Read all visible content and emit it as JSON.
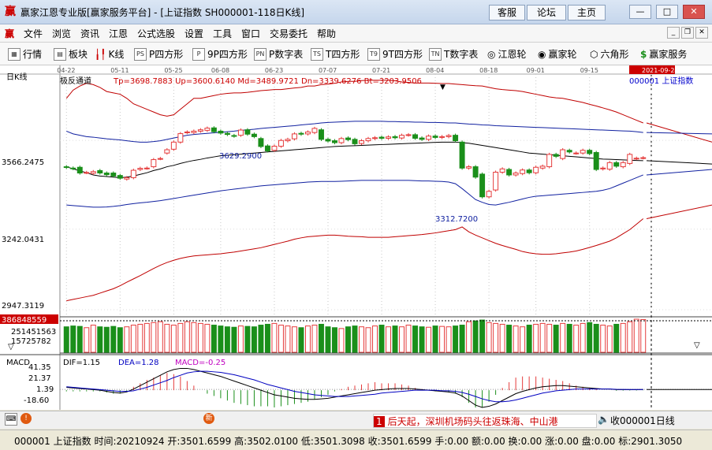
{
  "window": {
    "title": "赢家江恩专业版[赢家服务平台] - [上证指数  SH000001-118日K线]",
    "buttons": {
      "support": "客服",
      "forum": "论坛",
      "home": "主页"
    }
  },
  "menu": [
    "文件",
    "浏览",
    "资讯",
    "江恩",
    "公式选股",
    "设置",
    "工具",
    "窗口",
    "交易委托",
    "帮助"
  ],
  "toolbar": [
    "行情",
    "板块",
    "K线",
    "P四方形",
    "9P四方形",
    "P数字表",
    "T四方形",
    "9T四方形",
    "T数字表",
    "江恩轮",
    "赢家轮",
    "六角形",
    "赢家服务"
  ],
  "chart": {
    "panel_label": "日K线",
    "indicator_name": "极反通道",
    "indicator_values": "Tp=3698.7883  Up=3600.6140  Md=3489.9721  Dn=3339.6276  Bt=3203.9506",
    "symbol_label": "000001  上证指数",
    "date_ticks": [
      "04-22",
      "05-11",
      "05-25",
      "06-08",
      "06-23",
      "07-07",
      "07-21",
      "08-04",
      "08-18",
      "09-01",
      "09-15",
      "2021-09-24"
    ],
    "price_ticks": [
      "3566.2475",
      "3242.0431",
      "2947.3119"
    ],
    "annotations": {
      "high": "3629.2900",
      "low": "3312.7200"
    },
    "volume_ticks": [
      "386848559",
      "251451563",
      "15725782"
    ],
    "macd_label": "MACD",
    "dif": "DIF=1.15",
    "dea": "DEA=1.28",
    "macd": "MACD=-0.25",
    "macd_ticks": [
      "41.35",
      "21.37",
      "1.39",
      "-18.60"
    ]
  },
  "status": {
    "ticker": "后天起，深圳机场码头往返珠海、中山港",
    "right_label": "收000001日线"
  },
  "bottom": {
    "info": "000001 上证指数 时间:20210924 开:3501.6599 高:3502.0100 低:3501.3098 收:3501.6599 手:0.00 额:0.00 换:0.00 涨:0.00 盘:0.00 标:2901.3050"
  },
  "colors": {
    "up": "#e53c3c",
    "down": "#1a8f1a",
    "band_red": "#c00000",
    "band_blue": "#1020a0",
    "mid": "#000000"
  },
  "chart_data": {
    "type": "candlestick",
    "open": [
      3470,
      3465,
      3468,
      3449,
      3446,
      3456,
      3447,
      3447,
      3438,
      3425,
      3430,
      3460,
      3465,
      3470,
      3500,
      3520,
      3534,
      3560,
      3595,
      3595,
      3600,
      3603,
      3612,
      3600,
      3592,
      3584,
      3585,
      3605,
      3589,
      3573,
      3546,
      3530,
      3545,
      3565,
      3572,
      3592,
      3590,
      3595,
      3605,
      3570,
      3565,
      3558,
      3575,
      3570,
      3555,
      3565,
      3573,
      3578,
      3574,
      3580,
      3575,
      3586,
      3587,
      3575,
      3570,
      3582,
      3577,
      3580,
      3585,
      3560,
      3465,
      3470,
      3443,
      3360,
      3385,
      3450,
      3460,
      3440,
      3445,
      3458,
      3448,
      3465,
      3470,
      3515,
      3500,
      3530,
      3520,
      3520,
      3530,
      3522,
      3462,
      3461,
      3485,
      3470,
      3482,
      3500,
      3503
    ],
    "close": [
      3468,
      3463,
      3447,
      3449,
      3452,
      3447,
      3441,
      3436,
      3428,
      3430,
      3457,
      3464,
      3465,
      3496,
      3500,
      3532,
      3560,
      3591,
      3597,
      3600,
      3605,
      3611,
      3598,
      3593,
      3588,
      3582,
      3604,
      3589,
      3580,
      3544,
      3528,
      3545,
      3566,
      3570,
      3590,
      3589,
      3597,
      3610,
      3570,
      3564,
      3558,
      3573,
      3569,
      3554,
      3565,
      3573,
      3576,
      3574,
      3579,
      3576,
      3585,
      3587,
      3574,
      3570,
      3582,
      3577,
      3580,
      3584,
      3565,
      3465,
      3470,
      3432,
      3360,
      3380,
      3450,
      3462,
      3440,
      3447,
      3458,
      3448,
      3468,
      3472,
      3515,
      3508,
      3532,
      3524,
      3520,
      3530,
      3518,
      3460,
      3465,
      3485,
      3472,
      3485,
      3515,
      3501,
      3503
    ],
    "tp": [
      3720,
      3750,
      3765,
      3775,
      3770,
      3760,
      3745,
      3740,
      3735,
      3720,
      3700,
      3690,
      3680,
      3670,
      3660,
      3655,
      3660,
      3680,
      3700,
      3720,
      3720,
      3725,
      3730,
      3735,
      3738,
      3740,
      3740,
      3742,
      3745,
      3748,
      3750,
      3752,
      3752,
      3755,
      3758,
      3760,
      3765,
      3765,
      3770,
      3772,
      3775,
      3780,
      3782,
      3782,
      3785,
      3786,
      3786,
      3786,
      3786,
      3784,
      3780,
      3778,
      3776,
      3776,
      3776,
      3775,
      3774,
      3774,
      3772,
      3770,
      3768,
      3766,
      3765,
      3760,
      3755,
      3752,
      3750,
      3748,
      3745,
      3740,
      3735,
      3730,
      3725,
      3722,
      3720,
      3715,
      3710,
      3705,
      3698,
      3692,
      3685,
      3678,
      3670,
      3660,
      3650,
      3640,
      3630
    ],
    "up": [
      3600,
      3590,
      3585,
      3580,
      3578,
      3575,
      3572,
      3570,
      3568,
      3565,
      3562,
      3560,
      3560,
      3562,
      3565,
      3570,
      3575,
      3580,
      3585,
      3588,
      3590,
      3592,
      3594,
      3596,
      3598,
      3600,
      3603,
      3605,
      3607,
      3610,
      3612,
      3614,
      3616,
      3618,
      3620,
      3623,
      3625,
      3627,
      3630,
      3632,
      3633,
      3634,
      3635,
      3636,
      3636,
      3636,
      3636,
      3636,
      3635,
      3635,
      3634,
      3634,
      3633,
      3633,
      3632,
      3632,
      3631,
      3630,
      3630,
      3628,
      3626,
      3625,
      3623,
      3622,
      3620,
      3619,
      3618,
      3617,
      3616,
      3615,
      3614,
      3613,
      3612,
      3611,
      3610,
      3609,
      3608,
      3607,
      3606,
      3605,
      3604,
      3603,
      3602,
      3601,
      3600,
      3598,
      3595
    ],
    "mid": [
      3470,
      3462,
      3455,
      3448,
      3440,
      3436,
      3434,
      3432,
      3430,
      3432,
      3436,
      3442,
      3448,
      3456,
      3462,
      3470,
      3475,
      3482,
      3488,
      3493,
      3497,
      3502,
      3506,
      3510,
      3512,
      3514,
      3516,
      3518,
      3520,
      3522,
      3524,
      3526,
      3528,
      3530,
      3532,
      3534,
      3536,
      3538,
      3540,
      3542,
      3544,
      3545,
      3546,
      3547,
      3548,
      3549,
      3550,
      3551,
      3552,
      3553,
      3554,
      3555,
      3556,
      3557,
      3558,
      3559,
      3560,
      3560,
      3560,
      3558,
      3556,
      3552,
      3548,
      3544,
      3540,
      3536,
      3532,
      3528,
      3524,
      3520,
      3518,
      3516,
      3514,
      3512,
      3510,
      3508,
      3506,
      3504,
      3502,
      3500,
      3498,
      3497,
      3496,
      3495,
      3494,
      3493,
      3492
    ],
    "dn": [
      3330,
      3328,
      3326,
      3324,
      3322,
      3322,
      3323,
      3325,
      3328,
      3332,
      3335,
      3338,
      3340,
      3343,
      3346,
      3350,
      3354,
      3358,
      3362,
      3366,
      3370,
      3374,
      3378,
      3382,
      3385,
      3388,
      3391,
      3394,
      3397,
      3400,
      3402,
      3404,
      3406,
      3408,
      3410,
      3412,
      3414,
      3415,
      3416,
      3416,
      3416,
      3417,
      3418,
      3419,
      3420,
      3420,
      3420,
      3420,
      3420,
      3420,
      3420,
      3420,
      3419,
      3418,
      3418,
      3417,
      3416,
      3414,
      3408,
      3390,
      3370,
      3350,
      3340,
      3332,
      3330,
      3335,
      3340,
      3346,
      3352,
      3358,
      3362,
      3364,
      3366,
      3368,
      3370,
      3372,
      3374,
      3376,
      3378,
      3380,
      3384,
      3390,
      3400,
      3410,
      3420,
      3430,
      3440
    ],
    "bt": [
      2980,
      2985,
      2990,
      2995,
      3000,
      3008,
      3016,
      3024,
      3035,
      3048,
      3060,
      3072,
      3085,
      3098,
      3110,
      3120,
      3128,
      3135,
      3140,
      3144,
      3146,
      3148,
      3150,
      3152,
      3155,
      3158,
      3162,
      3166,
      3170,
      3174,
      3180,
      3186,
      3192,
      3198,
      3205,
      3210,
      3214,
      3216,
      3218,
      3220,
      3220,
      3218,
      3216,
      3215,
      3214,
      3212,
      3212,
      3212,
      3212,
      3214,
      3216,
      3218,
      3220,
      3222,
      3225,
      3228,
      3232,
      3236,
      3240,
      3250,
      3232,
      3220,
      3210,
      3200,
      3190,
      3182,
      3175,
      3168,
      3160,
      3155,
      3152,
      3150,
      3150,
      3152,
      3155,
      3158,
      3162,
      3168,
      3175,
      3182,
      3190,
      3198,
      3210,
      3225,
      3240,
      3260,
      3280
    ],
    "volume": [
      300,
      310,
      305,
      290,
      320,
      300,
      295,
      305,
      290,
      300,
      320,
      330,
      340,
      350,
      360,
      330,
      320,
      340,
      360,
      350,
      340,
      330,
      320,
      310,
      300,
      295,
      310,
      305,
      300,
      320,
      330,
      340,
      320,
      310,
      300,
      290,
      310,
      320,
      330,
      300,
      290,
      280,
      300,
      310,
      300,
      290,
      310,
      320,
      300,
      310,
      300,
      320,
      310,
      300,
      295,
      310,
      305,
      300,
      310,
      320,
      360,
      370,
      380,
      350,
      340,
      330,
      320,
      310,
      300,
      320,
      330,
      340,
      330,
      320,
      340,
      330,
      320,
      340,
      350,
      330,
      320,
      310,
      330,
      340,
      360,
      390,
      386
    ],
    "macd_dif": [
      5,
      4,
      3,
      2,
      1,
      0,
      -2,
      -4,
      -5,
      -3,
      2,
      8,
      14,
      20,
      26,
      32,
      36,
      38,
      38,
      36,
      33,
      30,
      27,
      24,
      20,
      16,
      12,
      8,
      4,
      0,
      -4,
      -8,
      -10,
      -12,
      -14,
      -15,
      -16,
      -16,
      -15,
      -14,
      -12,
      -10,
      -8,
      -6,
      -4,
      -2,
      0,
      1,
      2,
      3,
      3,
      3,
      2,
      1,
      0,
      -1,
      -2,
      -3,
      -5,
      -10,
      -18,
      -26,
      -30,
      -28,
      -24,
      -18,
      -12,
      -6,
      -2,
      1,
      4,
      6,
      7,
      8,
      8,
      7,
      6,
      5,
      4,
      3,
      2,
      2,
      1,
      1,
      1,
      1,
      1.15
    ],
    "macd_dea": [
      6,
      5,
      4,
      3,
      2,
      1,
      0,
      -1,
      -2,
      -2,
      -1,
      2,
      5,
      9,
      13,
      17,
      22,
      26,
      30,
      32,
      33,
      33,
      32,
      31,
      29,
      27,
      24,
      21,
      18,
      14,
      10,
      7,
      4,
      1,
      -2,
      -4,
      -6,
      -8,
      -9,
      -10,
      -11,
      -11,
      -11,
      -10,
      -9,
      -8,
      -7,
      -5,
      -4,
      -3,
      -2,
      -1,
      0,
      0,
      0,
      0,
      -1,
      -1,
      -2,
      -4,
      -7,
      -11,
      -15,
      -18,
      -20,
      -20,
      -19,
      -17,
      -14,
      -11,
      -8,
      -5,
      -3,
      -1,
      0,
      1,
      2,
      2,
      2,
      2,
      2,
      2,
      1.5,
      1.4,
      1.3,
      1.3,
      1.28
    ],
    "ylim_price": [
      2947.3119,
      3800
    ],
    "ylim_macd": [
      -30,
      41.35
    ]
  }
}
